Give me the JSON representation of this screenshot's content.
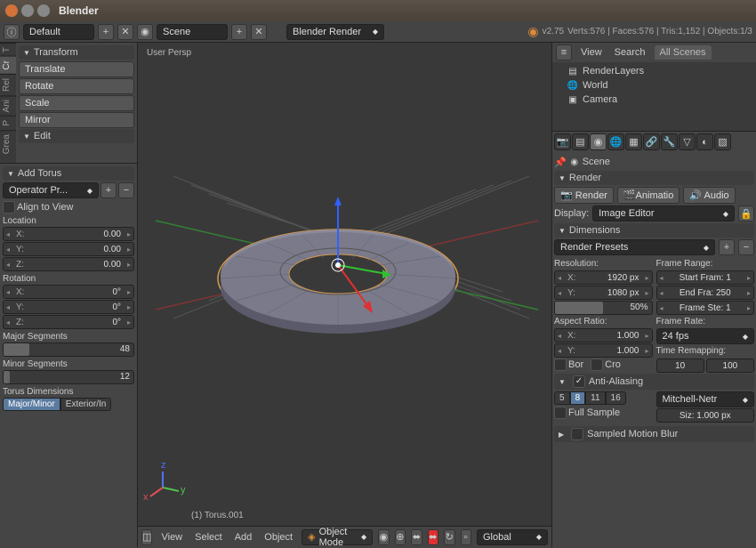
{
  "window_title": "Blender",
  "topbar": {
    "layout": "Default",
    "scene": "Scene",
    "engine": "Blender Render",
    "version": "v2.75",
    "stats": "Verts:576 | Faces:576 | Tris:1,152 | Objects:1/3"
  },
  "left_panel": {
    "vtabs": [
      "T",
      "Cr",
      "Rel",
      "Ani",
      "P",
      "Grea"
    ],
    "transform": {
      "title": "Transform",
      "translate": "Translate",
      "rotate": "Rotate",
      "scale": "Scale",
      "mirror": "Mirror"
    },
    "edit_title": "Edit",
    "add_torus": {
      "title": "Add Torus",
      "preset": "Operator Pr...",
      "align": "Align to View",
      "location_label": "Location",
      "loc_x": "0.00",
      "loc_y": "0.00",
      "loc_z": "0.00",
      "rotation_label": "Rotation",
      "rot_x": "0°",
      "rot_y": "0°",
      "rot_z": "0°",
      "major_seg_label": "Major Segments",
      "major_seg": "48",
      "minor_seg_label": "Minor Segments",
      "minor_seg": "12",
      "torus_dims_label": "Torus Dimensions",
      "dim_mode1": "Major/Minor",
      "dim_mode2": "Exterior/In"
    }
  },
  "viewport": {
    "persp": "User Persp",
    "object_label": "(1) Torus.001",
    "bottom": {
      "view": "View",
      "select": "Select",
      "add": "Add",
      "object": "Object",
      "mode": "Object Mode",
      "orientation": "Global"
    }
  },
  "outliner": {
    "view": "View",
    "search": "Search",
    "all_scenes": "All Scenes",
    "items": [
      "RenderLayers",
      "World",
      "Camera"
    ]
  },
  "props": {
    "scene_label": "Scene",
    "render_title": "Render",
    "render_btn": "Render",
    "anim_btn": "Animatio",
    "audio_btn": "Audio",
    "display_label": "Display:",
    "display_val": "Image Editor",
    "dimensions_title": "Dimensions",
    "presets": "Render Presets",
    "res_label": "Resolution:",
    "res_x": "1920 px",
    "res_y": "1080 px",
    "res_pct": "50%",
    "frame_range_label": "Frame Range:",
    "start_frame": "Start Fram: 1",
    "end_frame": "End Fra: 250",
    "frame_step": "Frame Ste: 1",
    "aspect_label": "Aspect Ratio:",
    "asp_x": "1.000",
    "asp_y": "1.000",
    "frame_rate_label": "Frame Rate:",
    "fps": "24 fps",
    "border": "Bor",
    "crop": "Cro",
    "time_remap_label": "Time Remapping:",
    "remap_old": "10",
    "remap_new": "100",
    "aa_title": "Anti-Aliasing",
    "aa_samples": [
      "5",
      "8",
      "11",
      "16"
    ],
    "aa_filter": "Mitchell-Netr",
    "full_sample": "Full Sample",
    "aa_size": "Siz: 1.000 px",
    "motion_blur": "Sampled Motion Blur"
  }
}
